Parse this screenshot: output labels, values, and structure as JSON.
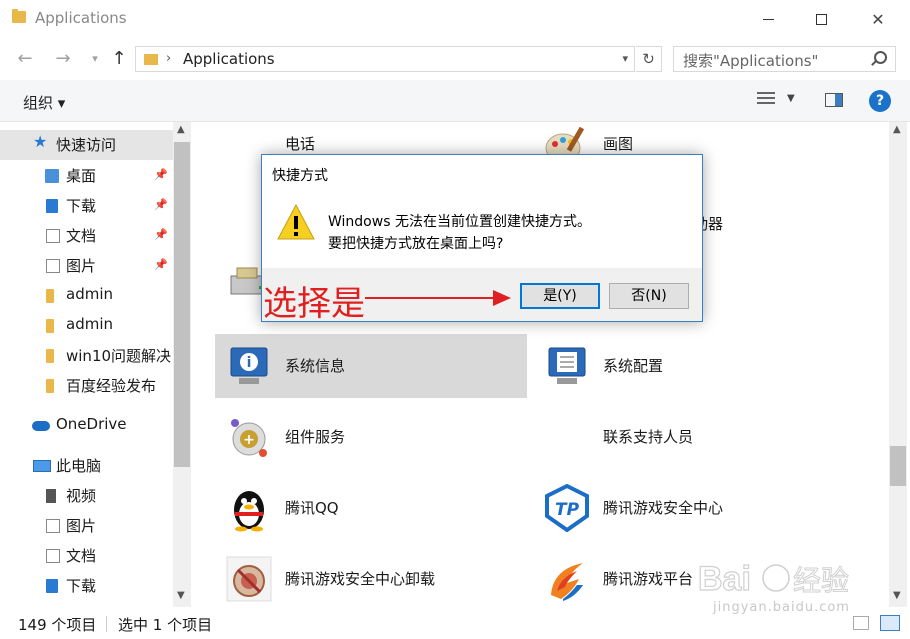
{
  "window": {
    "title": "Applications"
  },
  "address": {
    "path": "Applications"
  },
  "search": {
    "placeholder": "搜索\"Applications\""
  },
  "toolbar": {
    "organize_label": "组织 ▾",
    "help_label": "?"
  },
  "sidebar": {
    "items": [
      {
        "label": "快速访问",
        "icon": "star-icon"
      },
      {
        "label": "桌面",
        "icon": "folder-icon",
        "pinned": true
      },
      {
        "label": "下载",
        "icon": "download-icon",
        "pinned": true
      },
      {
        "label": "文档",
        "icon": "document-icon",
        "pinned": true
      },
      {
        "label": "图片",
        "icon": "picture-icon",
        "pinned": true
      },
      {
        "label": "admin",
        "icon": "folder-icon"
      },
      {
        "label": "admin",
        "icon": "folder-icon"
      },
      {
        "label": "win10问题解决",
        "icon": "folder-icon"
      },
      {
        "label": "百度经验发布",
        "icon": "folder-icon"
      },
      {
        "label": "OneDrive",
        "icon": "cloud-icon"
      },
      {
        "label": "此电脑",
        "icon": "computer-icon"
      },
      {
        "label": "视频",
        "icon": "video-icon"
      },
      {
        "label": "图片",
        "icon": "picture-icon"
      },
      {
        "label": "文档",
        "icon": "document-icon"
      },
      {
        "label": "下载",
        "icon": "download-icon"
      }
    ]
  },
  "files": {
    "items": [
      {
        "label": "电话",
        "icon": "phone-icon"
      },
      {
        "label": "画图",
        "icon": "paint-icon"
      },
      {
        "label": "驱动器",
        "icon": "drive-icon"
      },
      {
        "label": "系统信息",
        "icon": "system-info-icon",
        "selected": true
      },
      {
        "label": "系统配置",
        "icon": "system-config-icon"
      },
      {
        "label": "组件服务",
        "icon": "component-services-icon"
      },
      {
        "label": "联系支持人员",
        "icon": "support-icon"
      },
      {
        "label": "腾讯QQ",
        "icon": "qq-penguin-icon"
      },
      {
        "label": "腾讯游戏安全中心",
        "icon": "tp-shield-icon"
      },
      {
        "label": "腾讯游戏安全中心卸载",
        "icon": "uninstall-icon"
      },
      {
        "label": "腾讯游戏平台",
        "icon": "tencent-games-icon"
      }
    ]
  },
  "status": {
    "count": "149 个项目",
    "selection": "选中 1 个项目"
  },
  "dialog": {
    "title": "快捷方式",
    "line1": "Windows 无法在当前位置创建快捷方式。",
    "line2": "要把快捷方式放在桌面上吗?",
    "yes_label": "是(Y)",
    "no_label": "否(N)"
  },
  "annotation": {
    "text": "选择是"
  },
  "watermark": {
    "logo": "Baidu经验",
    "url": "jingyan.baidu.com"
  }
}
